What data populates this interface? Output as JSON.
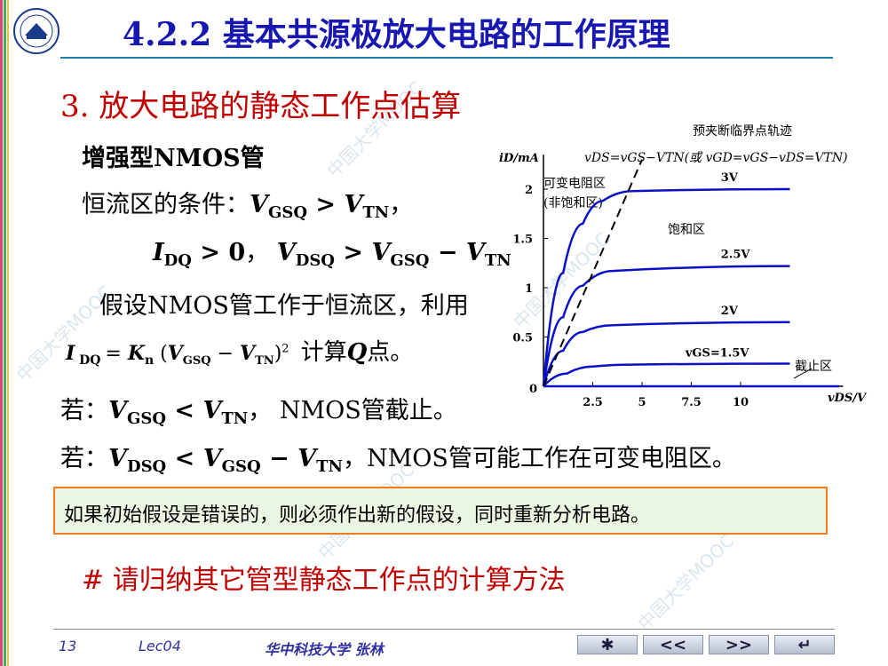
{
  "header": {
    "title": "4.2.2  基本共源极放大电路的工作原理"
  },
  "section": {
    "title": "3.  放大电路的静态工作点估算"
  },
  "body": {
    "type_label": "增强型NMOS管",
    "cond_prefix": "恒流区的条件：",
    "assume": "假设NMOS管工作于恒流区，利用",
    "formula_suffix": "计算",
    "formula_q": "Q",
    "formula_end": "点。",
    "if1_prefix": "若：",
    "if1_suffix": "，  NMOS管截止。",
    "if2_prefix": "若：",
    "if2_suffix": "，NMOS管可能工作在可变电阻区。",
    "note": "如果初始假设是错误的，则必须作出新的假设，同时重新分析电路。",
    "hash_line": "# 请归纳其它管型静态工作点的计算方法"
  },
  "chart_data": {
    "type": "line",
    "title": "预夹断临界点轨迹",
    "curve_eq": "vDS=vGS−VTN(或 vGD=vGS−vDS=VTN)",
    "xlabel": "vDS/V",
    "ylabel": "iD/mA",
    "x_ticks": [
      "2.5",
      "5",
      "7.5",
      "10"
    ],
    "x_tick_values": [
      2.5,
      5,
      7.5,
      10
    ],
    "y_ticks": [
      "0.5",
      "1",
      "1.5",
      "2"
    ],
    "y_tick_values": [
      0.5,
      1,
      1.5,
      2
    ],
    "origin_label": "0",
    "xlim": [
      0,
      15.2
    ],
    "ylim": [
      0,
      2.35
    ],
    "region_labels": {
      "variable": "可变电阻区",
      "variable_sub": "(非饱和区)",
      "saturation": "饱和区",
      "cutoff": "截止区"
    },
    "series": [
      {
        "name": "vGS=1.5V",
        "values": [
          [
            0,
            0
          ],
          [
            1.2,
            0.13
          ],
          [
            2.5,
            0.2
          ],
          [
            4.5,
            0.22
          ],
          [
            12.5,
            0.23
          ]
        ]
      },
      {
        "name": "2V",
        "values": [
          [
            0,
            0
          ],
          [
            1.0,
            0.36
          ],
          [
            2.0,
            0.55
          ],
          [
            3.5,
            0.62
          ],
          [
            12.5,
            0.65
          ]
        ]
      },
      {
        "name": "2.5V",
        "values": [
          [
            0,
            0
          ],
          [
            1.0,
            0.7
          ],
          [
            2.0,
            1.02
          ],
          [
            3.5,
            1.17
          ],
          [
            12.5,
            1.22
          ]
        ]
      },
      {
        "name": "3V",
        "values": [
          [
            0,
            0
          ],
          [
            1.0,
            1.15
          ],
          [
            2.0,
            1.65
          ],
          [
            3.0,
            1.88
          ],
          [
            4.5,
            1.98
          ],
          [
            12.5,
            2.0
          ]
        ]
      }
    ],
    "locus": [
      [
        0,
        0
      ],
      [
        5.0,
        2.3
      ]
    ],
    "cutoff_line": [
      [
        0,
        0
      ],
      [
        15,
        0
      ]
    ],
    "colors": {
      "curves": "#0a10c8",
      "locus": "#000000"
    }
  },
  "footer": {
    "page": "13",
    "lecture": "Lec04",
    "author": "华中科技大学   张林"
  },
  "nav": {
    "home": "✱",
    "prev": "<<",
    "next": ">>",
    "back": "↵"
  },
  "colors": {
    "title": "#1818b0",
    "section": "#c00000",
    "rule": "#1c7fb0",
    "note_border": "#f07a20"
  }
}
